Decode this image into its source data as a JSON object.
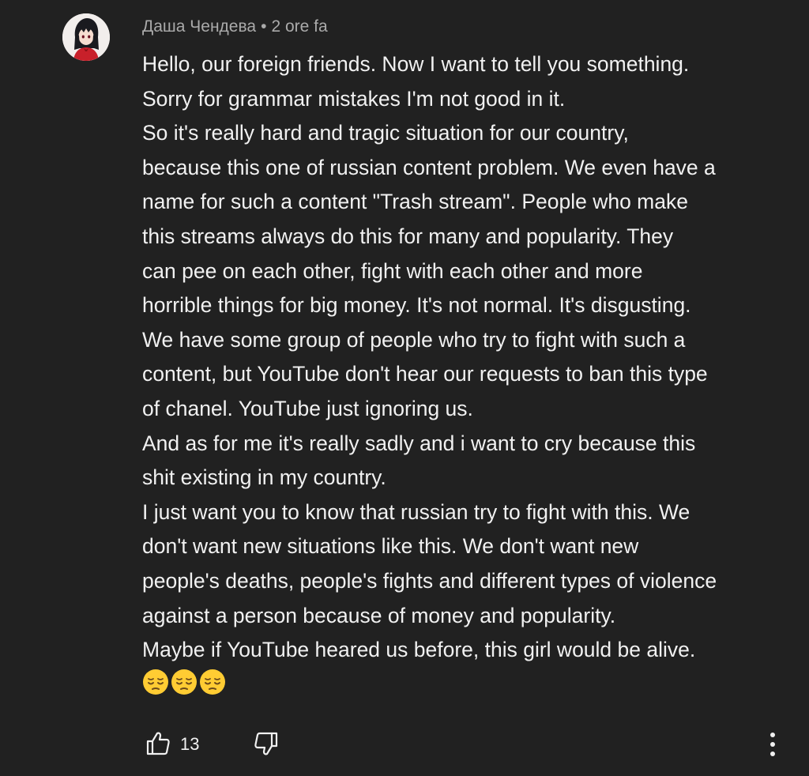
{
  "comment": {
    "author": "Даша Чендева",
    "separator": "•",
    "timestamp": "2 ore fa",
    "avatar_icon": "anime-girl-avatar-icon",
    "lines": [
      "Hello, our foreign friends. Now I want to tell you something.",
      "Sorry for grammar mistakes I'm not good in it.",
      "So it's really hard and tragic situation for our country,",
      "because this one of russian content problem. We even have a",
      "name for such a content \"Trash stream\". People who make",
      "this streams always do this for many and popularity. They",
      "can pee on each other, fight with each other and more",
      "horrible things for big money. It's not normal. It's disgusting.",
      "We have some group of people who try to fight with such a",
      "content, but YouTube don't hear our requests to ban this type",
      "of chanel. YouTube just ignoring us.",
      "And as for me it's really sadly and i want to cry because this",
      "shit existing in my country.",
      "I just want you to know that russian try to fight with this. We",
      "don't want new situations like this. We don't want new",
      "people's deaths, people's fights and different types of violence",
      "against a person because of money and popularity.",
      "Maybe if YouTube heared us before, this girl would be alive."
    ],
    "emojis": [
      "pensive-face-icon",
      "pensive-face-icon",
      "pensive-face-icon"
    ]
  },
  "actions": {
    "like_icon": "thumbs-up-icon",
    "like_count": "13",
    "dislike_icon": "thumbs-down-icon",
    "more_icon": "more-vertical-icon"
  },
  "colors": {
    "background": "#212121",
    "text": "#f1f1f1",
    "meta_text": "#aaaaaa",
    "emoji": "#ffcc33"
  }
}
